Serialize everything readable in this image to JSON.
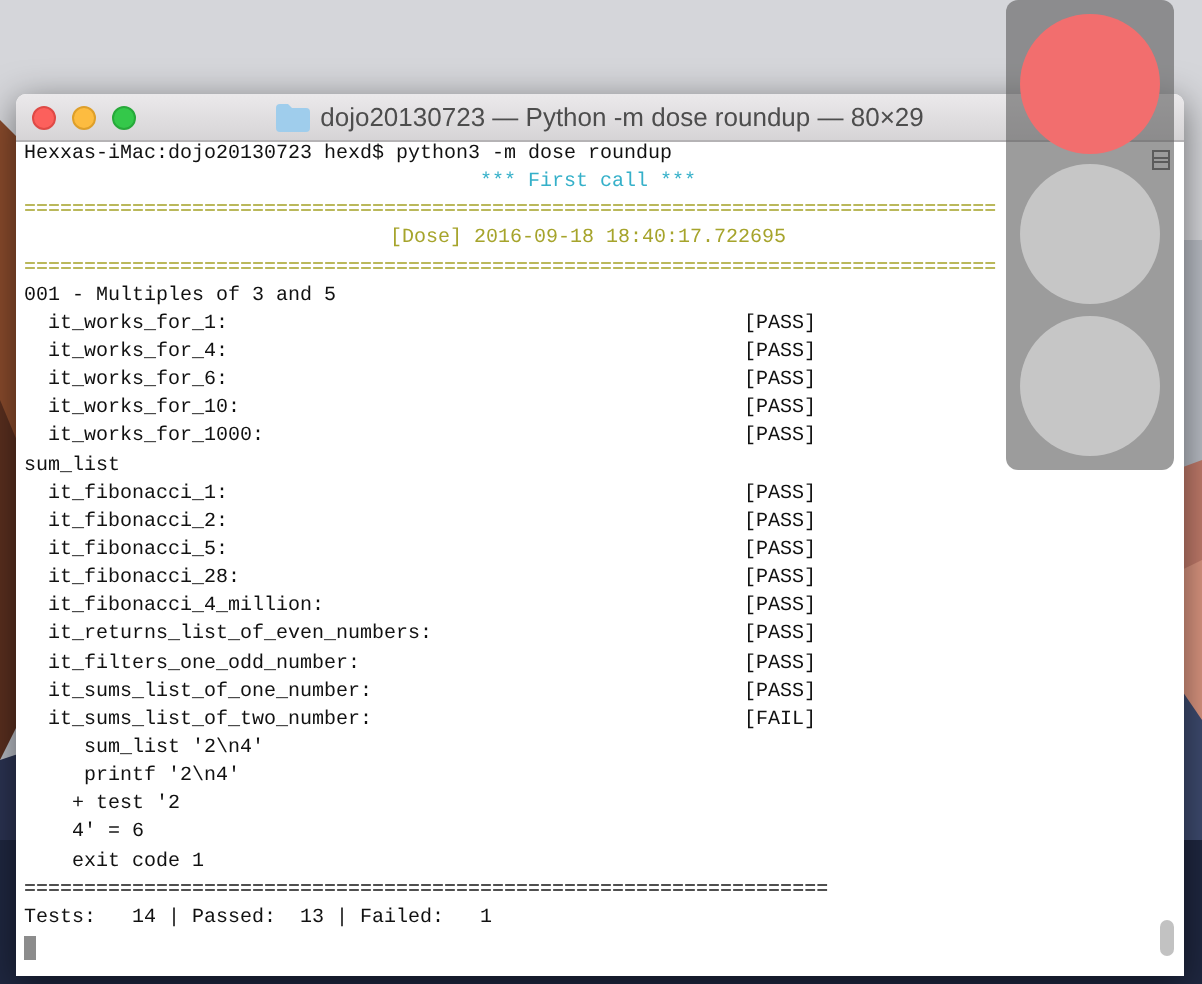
{
  "window": {
    "title": "dojo20130723 — Python -m dose roundup — 80×29"
  },
  "terminal": {
    "lines": [
      {
        "kind": "prompt",
        "text": "Hexxas-iMac:dojo20130723 hexd$ python3 -m dose roundup"
      },
      {
        "kind": "banner",
        "text": "*** First call ***"
      },
      {
        "kind": "rule",
        "text": "================================================================================="
      },
      {
        "kind": "stamp",
        "text": "[Dose] 2016-09-18 18:40:17.722695"
      },
      {
        "kind": "rule",
        "text": "================================================================================="
      },
      {
        "kind": "plain",
        "text": "001 - Multiples of 3 and 5"
      },
      {
        "kind": "test",
        "text": "  it_works_for_1:",
        "result": "[PASS]"
      },
      {
        "kind": "test",
        "text": "  it_works_for_4:",
        "result": "[PASS]"
      },
      {
        "kind": "test",
        "text": "  it_works_for_6:",
        "result": "[PASS]"
      },
      {
        "kind": "test",
        "text": "  it_works_for_10:",
        "result": "[PASS]"
      },
      {
        "kind": "test",
        "text": "  it_works_for_1000:",
        "result": "[PASS]"
      },
      {
        "kind": "plain",
        "text": "sum_list"
      },
      {
        "kind": "test",
        "text": "  it_fibonacci_1:",
        "result": "[PASS]"
      },
      {
        "kind": "test",
        "text": "  it_fibonacci_2:",
        "result": "[PASS]"
      },
      {
        "kind": "test",
        "text": "  it_fibonacci_5:",
        "result": "[PASS]"
      },
      {
        "kind": "test",
        "text": "  it_fibonacci_28:",
        "result": "[PASS]"
      },
      {
        "kind": "test",
        "text": "  it_fibonacci_4_million:",
        "result": "[PASS]"
      },
      {
        "kind": "test",
        "text": "  it_returns_list_of_even_numbers:",
        "result": "[PASS]"
      },
      {
        "kind": "test",
        "text": "  it_filters_one_odd_number:",
        "result": "[PASS]"
      },
      {
        "kind": "test",
        "text": "  it_sums_list_of_one_number:",
        "result": "[PASS]"
      },
      {
        "kind": "test",
        "text": "  it_sums_list_of_two_number:",
        "result": "[FAIL]"
      },
      {
        "kind": "plain",
        "text": "     sum_list '2\\n4'"
      },
      {
        "kind": "plain",
        "text": "     printf '2\\n4'"
      },
      {
        "kind": "plain",
        "text": "    + test '2"
      },
      {
        "kind": "plain",
        "text": "    4' = 6"
      },
      {
        "kind": "plain",
        "text": "    exit code 1"
      },
      {
        "kind": "plain",
        "text": "==================================================================="
      },
      {
        "kind": "plain",
        "text": "Tests:   14 | Passed:  13 | Failed:   1"
      },
      {
        "kind": "cursor"
      }
    ]
  },
  "traffic_light": {
    "lights": [
      {
        "color": "#f26e6e"
      },
      {
        "color": "#c6c6c6"
      },
      {
        "color": "#c6c6c6"
      }
    ]
  }
}
